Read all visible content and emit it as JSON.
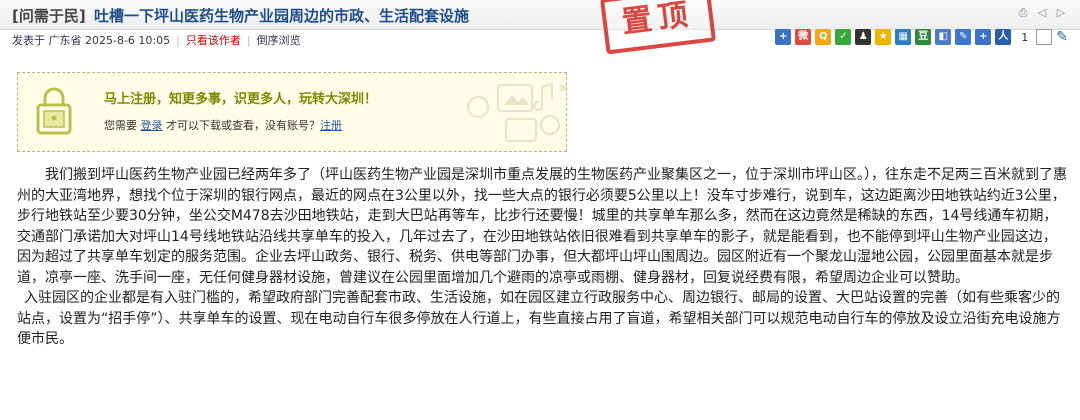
{
  "post": {
    "tag": "[问需于民]",
    "title": "吐槽一下坪山医药生物产业园周边的市政、生活配套设施",
    "stamp": "置顶"
  },
  "meta": {
    "posted": "发表于 广东省 2025-8-6 10:05",
    "only_author": "只看该作者",
    "reverse": "倒序浏览"
  },
  "toolbar": {
    "title_tools": [
      "print-icon",
      "prev-arrow-icon",
      "next-arrow-icon"
    ],
    "share_icons": [
      {
        "name": "add-icon",
        "glyph": "+",
        "color": "#3b73c4"
      },
      {
        "name": "weibo-icon",
        "glyph": "微",
        "color": "#e04b3b"
      },
      {
        "name": "qzone-icon",
        "glyph": "Q",
        "color": "#f2a618"
      },
      {
        "name": "wechat-icon",
        "glyph": "✓",
        "color": "#37a93c"
      },
      {
        "name": "qq-icon",
        "glyph": "♟",
        "color": "#333333"
      },
      {
        "name": "star-icon",
        "glyph": "★",
        "color": "#f0b400"
      },
      {
        "name": "qrcode-icon",
        "glyph": "▦",
        "color": "#2a7fc4"
      },
      {
        "name": "douban-icon",
        "glyph": "豆",
        "color": "#2e8b3c"
      },
      {
        "name": "bookmark-icon",
        "glyph": "◧",
        "color": "#4a7ac9"
      },
      {
        "name": "edit-icon",
        "glyph": "✎",
        "color": "#3b78d0"
      },
      {
        "name": "plus-icon",
        "glyph": "+",
        "color": "#3b73c4"
      },
      {
        "name": "renren-icon",
        "glyph": "人",
        "color": "#2a5fb0"
      }
    ],
    "count": "1"
  },
  "login": {
    "headline": "马上注册，知更多事，识更多人，玩转大深圳！",
    "prompt_before": "您需要 ",
    "login_link": "登录",
    "prompt_middle": " 才可以下载或查看，没有账号？",
    "register_link": "注册"
  },
  "body": {
    "paragraph1": "我们搬到坪山医药生物产业园已经两年多了（坪山医药生物产业园是深圳市重点发展的生物医药产业聚集区之一，位于深圳市坪山区。），往东走不足两三百米就到了惠州的大亚湾地界，想找个位于深圳的银行网点，最近的网点在3公里以外，找一些大点的银行必须要5公里以上！没车寸步难行，说到车，这边距离沙田地铁站约近3公里，步行地铁站至少要30分钟，坐公交M478去沙田地铁站，走到大巴站再等车，比步行还要慢！城里的共享单车那么多，然而在这边竟然是稀缺的东西，14号线通车初期，交通部门承诺加大对坪山14号线地铁站沿线共享单车的投入，几年过去了，在沙田地铁站依旧很难看到共享单车的影子，就是能看到，也不能停到坪山生物产业园这边，因为超过了共享单车划定的服务范围。企业去坪山政务、银行、税务、供电等部门办事，但大都坪山坪山围周边。园区附近有一个聚龙山湿地公园，公园里面基本就是步道，凉亭一座、洗手间一座，无任何健身器材设施，曾建议在公园里面增加几个避雨的凉亭或雨棚、健身器材，回复说经费有限，希望周边企业可以赞助。",
    "paragraph2": "入驻园区的企业都是有入驻门槛的，希望政府部门完善配套市政、生活设施，如在园区建立行政服务中心、周边银行、邮局的设置、大巴站设置的完善（如有些乘客少的站点，设置为“招手停”）、共享单车的设置、现在电动自行车很多停放在人行道上，有些直接占用了盲道，希望相关部门可以规范电动自行车的停放及设立沿街充电设施方便市民。"
  }
}
